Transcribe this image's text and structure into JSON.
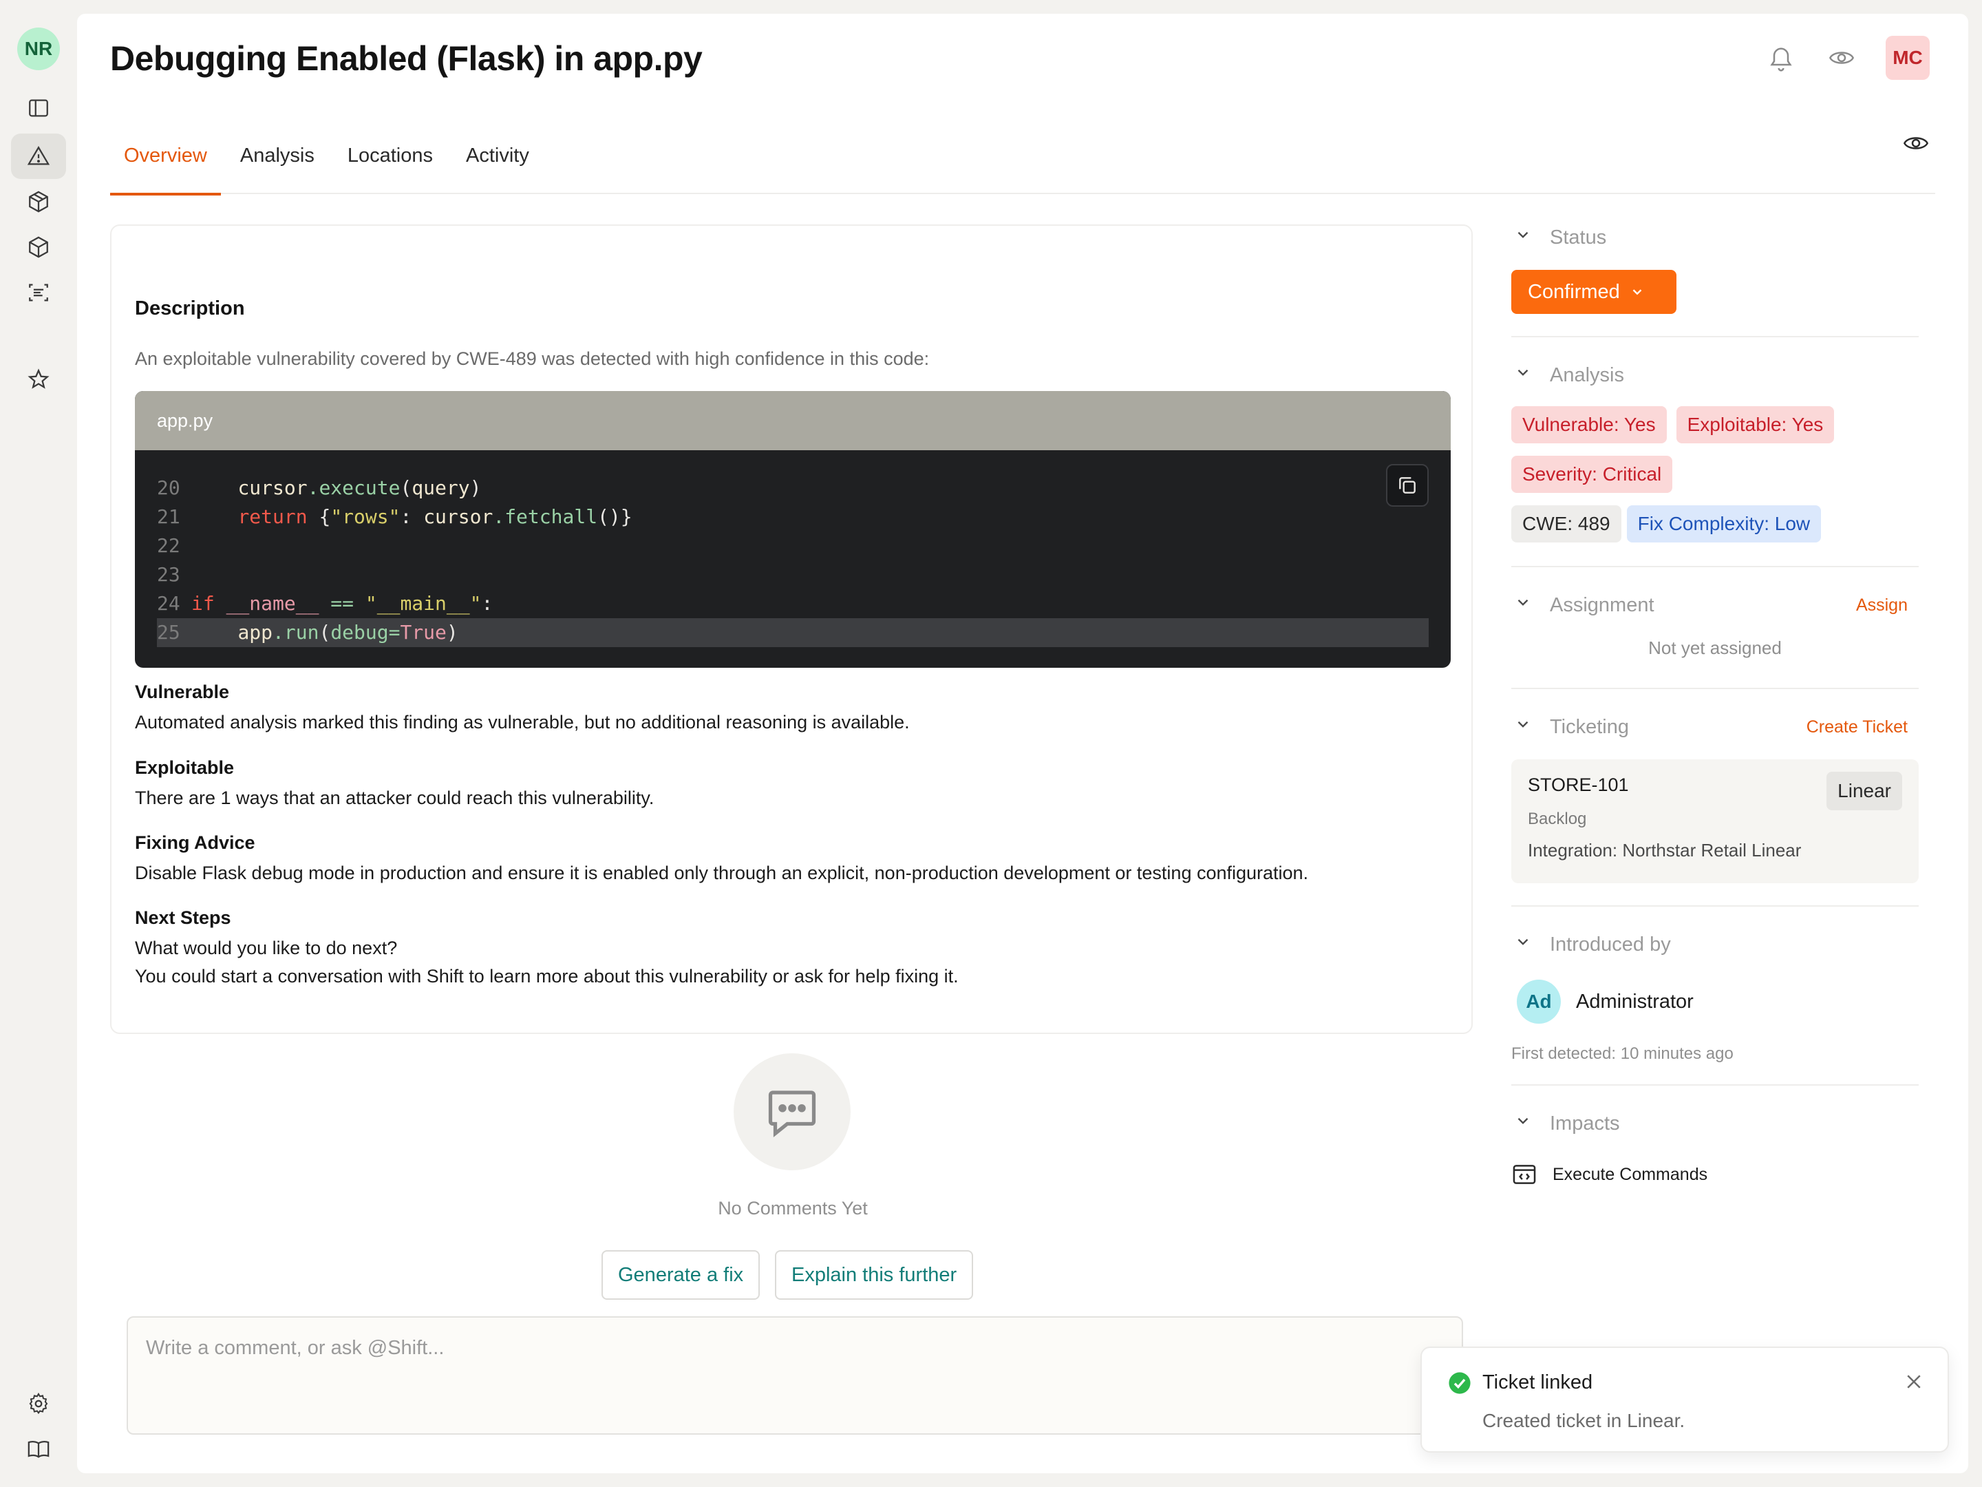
{
  "rail": {
    "workspace_initials": "NR"
  },
  "header": {
    "title": "Debugging Enabled (Flask) in app.py",
    "user_initials": "MC"
  },
  "tabs": [
    {
      "label": "Overview",
      "active": true
    },
    {
      "label": "Analysis",
      "active": false
    },
    {
      "label": "Locations",
      "active": false
    },
    {
      "label": "Activity",
      "active": false
    }
  ],
  "description": {
    "heading": "Description",
    "intro": "An exploitable vulnerability covered by CWE-489 was detected with high confidence in this code:",
    "code": {
      "filename": "app.py",
      "line_numbers": [
        "20",
        "21",
        "22",
        "23",
        "24",
        "25"
      ],
      "highlighted_line": "25"
    },
    "sections": [
      {
        "title": "Vulnerable",
        "lines": [
          "Automated analysis marked this finding as vulnerable, but no additional reasoning is available."
        ]
      },
      {
        "title": "Exploitable",
        "lines": [
          "There are 1 ways that an attacker could reach this vulnerability."
        ]
      },
      {
        "title": "Fixing Advice",
        "lines": [
          "Disable Flask debug mode in production and ensure it is enabled only through an explicit, non-production development or testing configuration."
        ]
      },
      {
        "title": "Next Steps",
        "lines": [
          "What would you like to do next?",
          "You could start a conversation with Shift to learn more about this vulnerability or ask for help fixing it."
        ]
      }
    ]
  },
  "comments": {
    "empty_text": "No Comments Yet",
    "suggestions": [
      "Generate a fix",
      "Explain this further"
    ],
    "placeholder": "Write a comment, or ask @Shift..."
  },
  "sidebar": {
    "status": {
      "title": "Status",
      "value": "Confirmed"
    },
    "analysis": {
      "title": "Analysis",
      "badges": {
        "vulnerable": "Vulnerable: Yes",
        "exploitable": "Exploitable: Yes",
        "severity": "Severity: Critical",
        "cwe": "CWE: 489",
        "fix_complexity": "Fix Complexity: Low"
      }
    },
    "assignment": {
      "title": "Assignment",
      "action": "Assign",
      "empty": "Not yet assigned"
    },
    "ticketing": {
      "title": "Ticketing",
      "action": "Create Ticket",
      "ticket": {
        "id": "STORE-101",
        "status": "Backlog",
        "integration": "Integration: Northstar Retail Linear",
        "provider": "Linear"
      }
    },
    "introduced_by": {
      "title": "Introduced by",
      "initials": "Ad",
      "name": "Administrator",
      "first_detected": "First detected: 10 minutes ago"
    },
    "impacts": {
      "title": "Impacts",
      "items": [
        "Execute Commands"
      ]
    }
  },
  "toast": {
    "title": "Ticket linked",
    "body": "Created ticket in Linear."
  },
  "colors": {
    "accent": "#e4580d",
    "status": "#fb6a0e",
    "success": "#2db84b"
  }
}
